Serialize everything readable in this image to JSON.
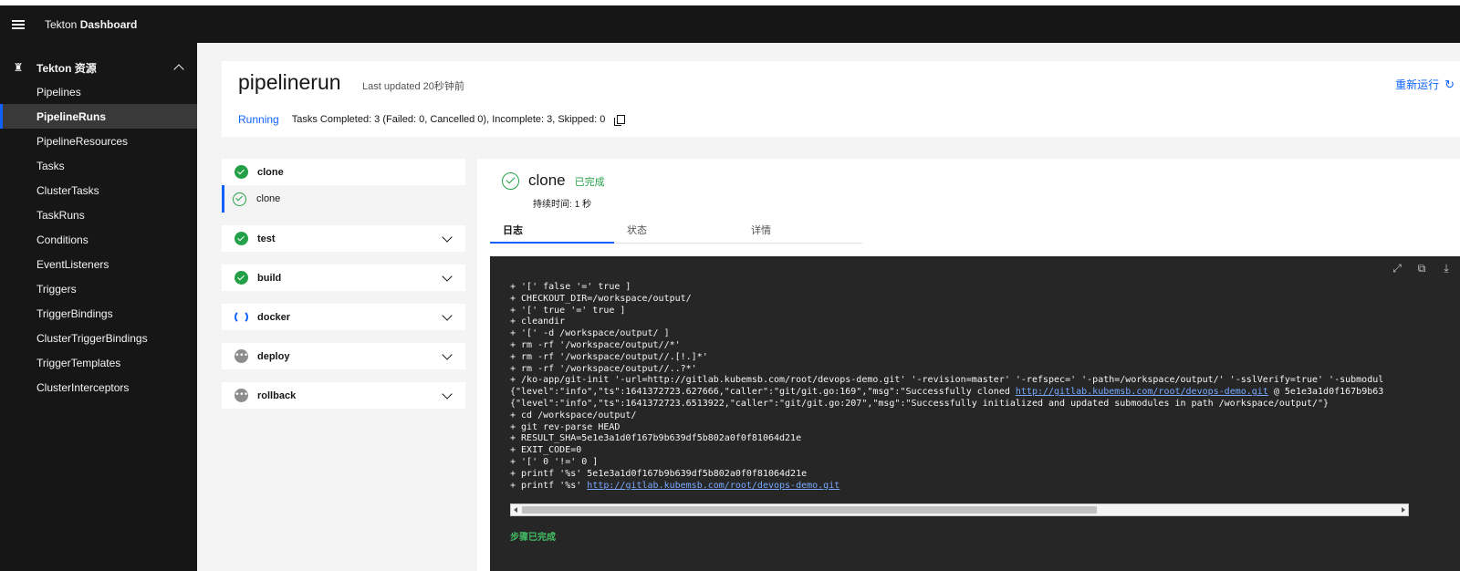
{
  "header": {
    "brand_prefix": "Tekton",
    "brand_bold": "Dashboard"
  },
  "sidebar": {
    "group_label": "Tekton 资源",
    "items": [
      {
        "label": "Pipelines",
        "active": false
      },
      {
        "label": "PipelineRuns",
        "active": true
      },
      {
        "label": "PipelineResources",
        "active": false
      },
      {
        "label": "Tasks",
        "active": false
      },
      {
        "label": "ClusterTasks",
        "active": false
      },
      {
        "label": "TaskRuns",
        "active": false
      },
      {
        "label": "Conditions",
        "active": false
      },
      {
        "label": "EventListeners",
        "active": false
      },
      {
        "label": "Triggers",
        "active": false
      },
      {
        "label": "TriggerBindings",
        "active": false
      },
      {
        "label": "ClusterTriggerBindings",
        "active": false
      },
      {
        "label": "TriggerTemplates",
        "active": false
      },
      {
        "label": "ClusterInterceptors",
        "active": false
      }
    ]
  },
  "run": {
    "title": "pipelinerun",
    "last_updated": "Last updated 20秒钟前",
    "rerun_label": "重新运行",
    "status": "Running",
    "summary": "Tasks Completed: 3 (Failed: 0, Cancelled 0), Incomplete: 3, Skipped: 0"
  },
  "tasks": [
    {
      "name": "clone",
      "state": "succeeded",
      "expanded": true,
      "steps": [
        {
          "name": "clone",
          "state": "succeeded"
        }
      ]
    },
    {
      "name": "test",
      "state": "succeeded",
      "expanded": false
    },
    {
      "name": "build",
      "state": "succeeded",
      "expanded": false
    },
    {
      "name": "docker",
      "state": "running",
      "expanded": false
    },
    {
      "name": "deploy",
      "state": "pending",
      "expanded": false
    },
    {
      "name": "rollback",
      "state": "pending",
      "expanded": false
    }
  ],
  "step": {
    "name": "clone",
    "status": "已完成",
    "duration_label": "持续时间:",
    "duration_value": "1 秒",
    "tabs": [
      {
        "label": "日志",
        "active": true
      },
      {
        "label": "状态",
        "active": false
      },
      {
        "label": "详情",
        "active": false
      }
    ],
    "log": [
      {
        "text": "+ '[' false '=' true ]"
      },
      {
        "text": "+ CHECKOUT_DIR=/workspace/output/"
      },
      {
        "text": "+ '[' true '=' true ]"
      },
      {
        "text": "+ cleandir"
      },
      {
        "text": "+ '[' -d /workspace/output/ ]"
      },
      {
        "text": "+ rm -rf '/workspace/output//*'"
      },
      {
        "text": "+ rm -rf '/workspace/output//.[!.]*'"
      },
      {
        "text": "+ rm -rf '/workspace/output//..?*'"
      },
      {
        "text": "+ /ko-app/git-init '-url=http://gitlab.kubemsb.com/root/devops-demo.git' '-revision=master' '-refspec=' '-path=/workspace/output/' '-sslVerify=true' '-submodul"
      },
      {
        "text": "{\"level\":\"info\",\"ts\":1641372723.627666,\"caller\":\"git/git.go:169\",\"msg\":\"Successfully cloned ",
        "link": "http://gitlab.kubemsb.com/root/devops-demo.git",
        "after": " @ 5e1e3a1d0f167b9b63"
      },
      {
        "text": "{\"level\":\"info\",\"ts\":1641372723.6513922,\"caller\":\"git/git.go:207\",\"msg\":\"Successfully initialized and updated submodules in path /workspace/output/\"}"
      },
      {
        "text": "+ cd /workspace/output/"
      },
      {
        "text": "+ git rev-parse HEAD"
      },
      {
        "text": "+ RESULT_SHA=5e1e3a1d0f167b9b639df5b802a0f0f81064d21e"
      },
      {
        "text": "+ EXIT_CODE=0"
      },
      {
        "text": "+ '[' 0 '!=' 0 ]"
      },
      {
        "text": "+ printf '%s' 5e1e3a1d0f167b9b639df5b802a0f0f81064d21e"
      },
      {
        "text": "+ printf '%s' ",
        "link": "http://gitlab.kubemsb.com/root/devops-demo.git",
        "after": ""
      }
    ],
    "done_label": "步骤已完成"
  }
}
